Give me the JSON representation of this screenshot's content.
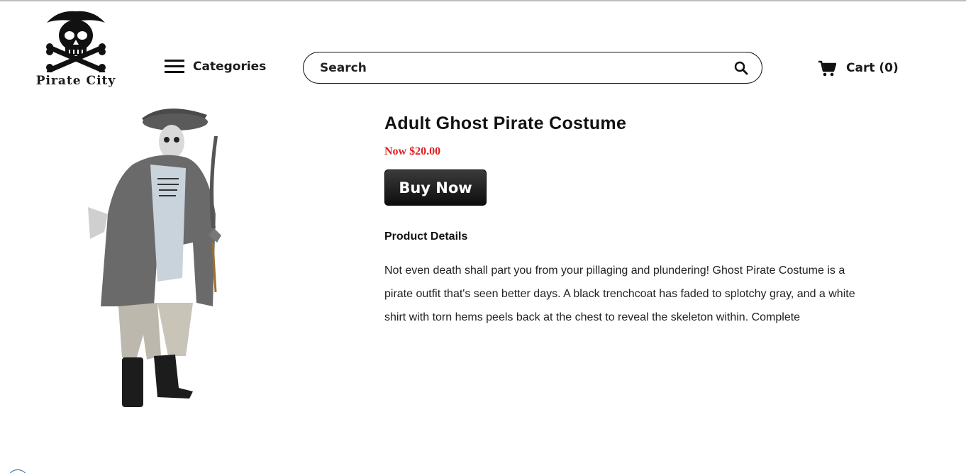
{
  "header": {
    "logo_text": "Pirate City",
    "categories_label": "Categories",
    "search_placeholder": "Search",
    "cart_label": "Cart (0)"
  },
  "product": {
    "title": "Adult Ghost Pirate Costume",
    "price": "Now $20.00",
    "buy_label": "Buy Now",
    "details_heading": "Product Details",
    "description": "Not even death shall part you from your pillaging and plundering! Ghost Pirate Costume is a pirate outfit that's seen better days. A black trenchcoat has faded to splotchy gray, and a white shirt with torn hems peels back at the chest to reveal the skeleton within. Complete"
  },
  "colors": {
    "price": "#e02020",
    "button": "#1a1a1a"
  },
  "icons": {
    "menu": "hamburger-icon",
    "search": "search-icon",
    "cart": "cart-icon",
    "logo": "skull-crossbones-logo"
  }
}
